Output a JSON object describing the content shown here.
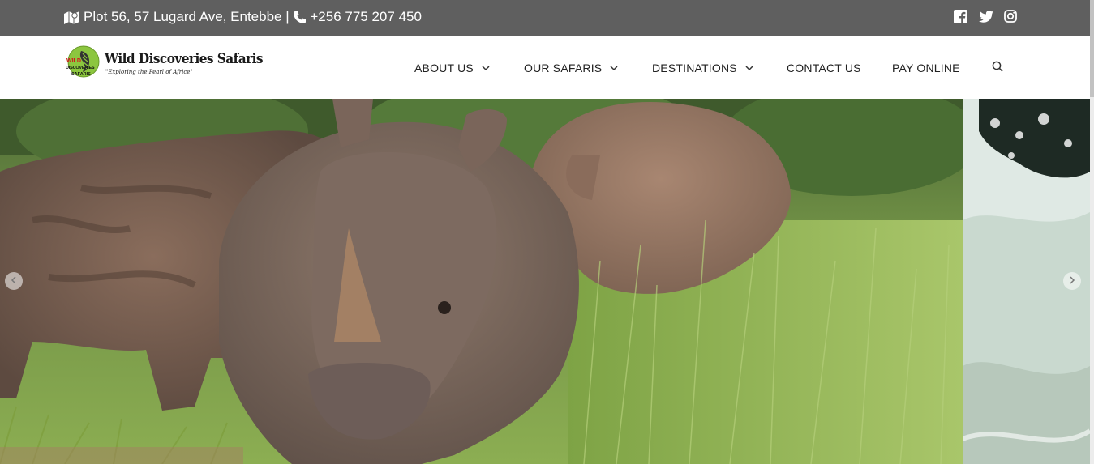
{
  "topbar": {
    "address": "Plot 56, 57 Lugard Ave, Entebbe",
    "separator": " | ",
    "phone": "+256 775 207 450",
    "social": [
      "facebook-icon",
      "twitter-icon",
      "instagram-icon"
    ]
  },
  "brand": {
    "name": "Wild Discoveries Safaris",
    "tagline": "\"Exploring the Pearl of Africe\"",
    "badge_top": "WILD",
    "badge_mid": "DISCOVERIES",
    "badge_bottom": "SAFARIS"
  },
  "nav": {
    "items": [
      {
        "label": "ABOUT US",
        "has_dropdown": true
      },
      {
        "label": "OUR SAFARIS",
        "has_dropdown": true
      },
      {
        "label": "DESTINATIONS",
        "has_dropdown": true
      },
      {
        "label": "CONTACT US",
        "has_dropdown": false
      },
      {
        "label": "PAY ONLINE",
        "has_dropdown": false
      }
    ],
    "search_icon": "search-icon"
  },
  "hero": {
    "current_slide": "rhinos-grazing",
    "next_slide": "waterfall-rapids",
    "prev_arrow": "chevron-left-icon",
    "next_arrow": "chevron-right-icon"
  },
  "colors": {
    "topbar": "#5f5f5f",
    "nav_text": "#222222",
    "white": "#ffffff"
  }
}
